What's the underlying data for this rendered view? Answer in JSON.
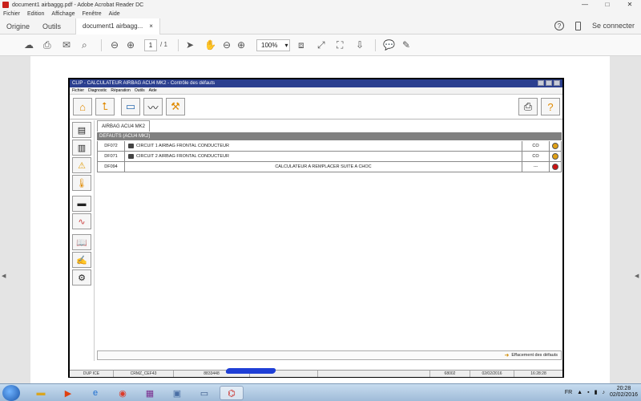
{
  "window": {
    "title": "document1 airbaggg.pdf - Adobe Acrobat Reader DC",
    "controls": [
      "—",
      "□",
      "✕"
    ]
  },
  "menu": [
    "Fichier",
    "Edition",
    "Affichage",
    "Fenêtre",
    "Aide"
  ],
  "nav": {
    "home": "Origine",
    "tools": "Outils",
    "doc_tab": "document1 airbagg...",
    "doc_tab_close": "×",
    "help_icon": "?",
    "signin": "Se connecter"
  },
  "toolbar": {
    "page_current": "1",
    "page_total": "/ 1",
    "zoom": "100%",
    "zoom_arrow": "▾"
  },
  "embedded_app": {
    "title": "CLIP - CALCULATEUR AIRBAG ACU4 MK2 - Contrôle des défauts",
    "menu": [
      "Fichier",
      "Diagnostic",
      "Réparation",
      "Outils",
      "Aide"
    ],
    "ecu_tab": "AIRBAG ACU4 MK2",
    "section": "DEFAUTS (ACU4 MK2)",
    "faults": [
      {
        "code": "DF072",
        "description": "CIRCUIT 1 AIRBAG FRONTAL CONDUCTEUR",
        "status": "CO",
        "indicator_color": "#e0a015"
      },
      {
        "code": "DF071",
        "description": "CIRCUIT 2 AIRBAG FRONTAL CONDUCTEUR",
        "status": "CO",
        "indicator_color": "#e0a015"
      },
      {
        "code": "DF094",
        "description": "CALCULATEUR A REMPLACER SUITE A CHOC",
        "status": "---",
        "indicator_color": "#cc1111"
      }
    ],
    "erase_label": "Effacement des défauts",
    "status_bar": [
      "DUP ICE",
      "CRMZ_CEF43",
      "8833448",
      "",
      "",
      "68002",
      "02/02/2016",
      "16:28:28"
    ]
  },
  "taskbar": {
    "lang": "FR",
    "time": "20:28",
    "date": "02/02/2016"
  },
  "colors": {
    "app_title_bar": "#2b3f8f",
    "section_bar": "#808080",
    "fault_warning": "#e0a015",
    "fault_critical": "#cc1111"
  }
}
